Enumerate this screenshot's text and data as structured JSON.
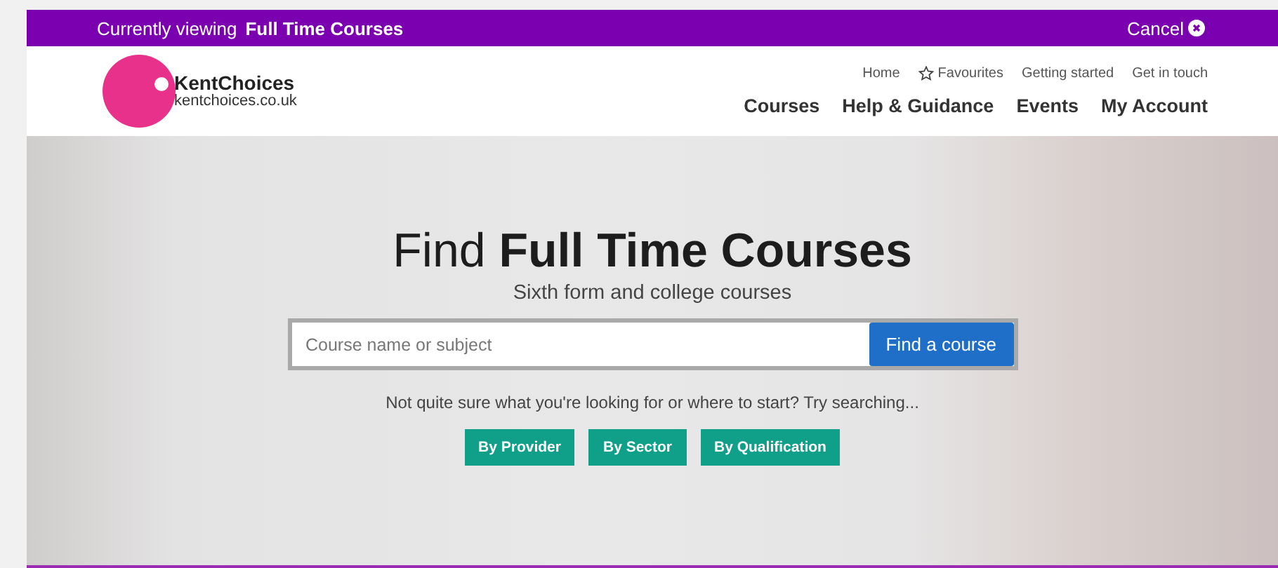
{
  "banner": {
    "label": "Currently viewing",
    "value": "Full Time Courses",
    "cancel": "Cancel"
  },
  "logo": {
    "name": "KentChoices",
    "url": "kentchoices.co.uk"
  },
  "top_links": [
    {
      "label": "Home",
      "kind": "plain"
    },
    {
      "label": "Favourites",
      "kind": "star"
    },
    {
      "label": "Getting started",
      "kind": "plain"
    },
    {
      "label": "Get in touch",
      "kind": "plain"
    }
  ],
  "main_nav": [
    "Courses",
    "Help & Guidance",
    "Events",
    "My Account"
  ],
  "hero": {
    "title": "Find **Full Time Courses**",
    "subtitle": "Sixth form and college courses",
    "search": {
      "placeholder": "Course name or subject",
      "button": "Find a course"
    },
    "hint": "Not quite sure what you're looking for or where to start? Try searching...",
    "buttons": [
      "By Provider",
      "By Sector",
      "By Qualification"
    ]
  }
}
